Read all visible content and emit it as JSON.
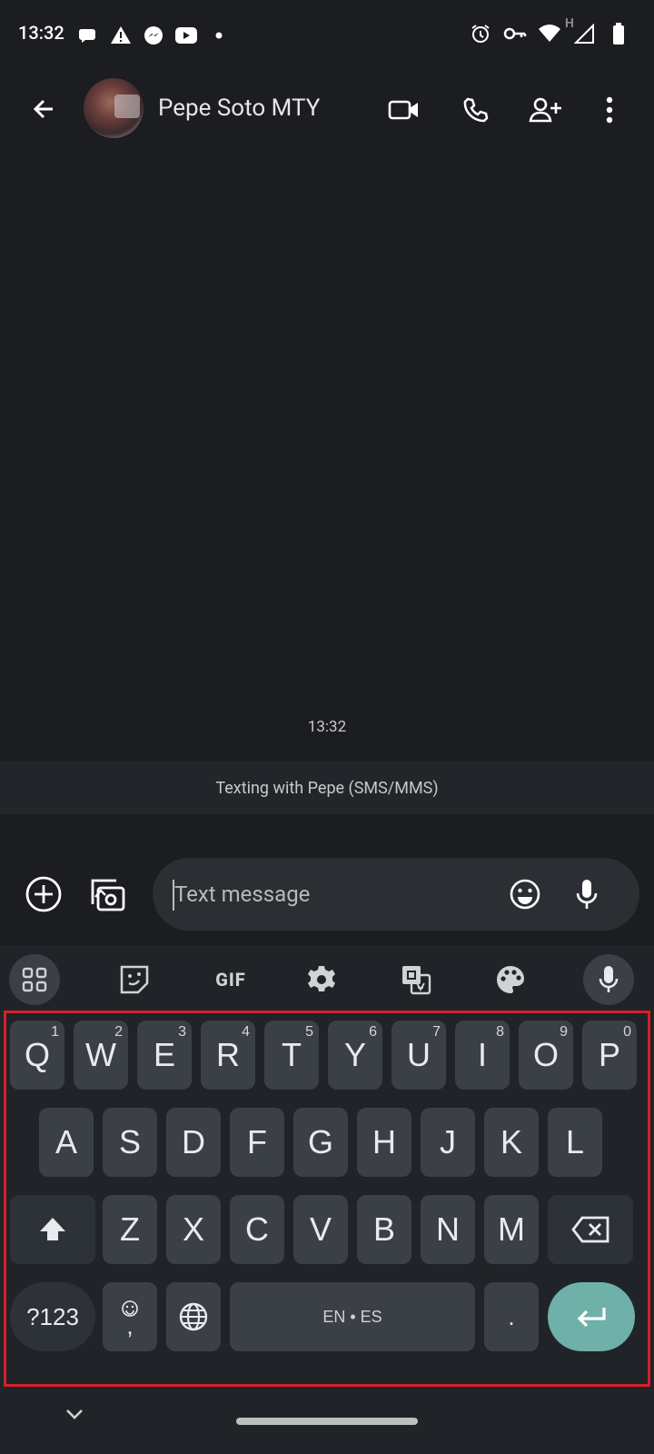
{
  "status_bar": {
    "time": "13:32",
    "network_label": "H"
  },
  "header": {
    "contact_name": "Pepe Soto MTY"
  },
  "conversation": {
    "timestamp": "13:32",
    "banner": "Texting with Pepe (SMS/MMS)"
  },
  "compose": {
    "placeholder": "Text message",
    "value": ""
  },
  "keyboard": {
    "toolbar": {
      "gif_label": "GIF"
    },
    "row1": [
      {
        "label": "Q",
        "hint": "1"
      },
      {
        "label": "W",
        "hint": "2"
      },
      {
        "label": "E",
        "hint": "3"
      },
      {
        "label": "R",
        "hint": "4"
      },
      {
        "label": "T",
        "hint": "5"
      },
      {
        "label": "Y",
        "hint": "6"
      },
      {
        "label": "U",
        "hint": "7"
      },
      {
        "label": "I",
        "hint": "8"
      },
      {
        "label": "O",
        "hint": "9"
      },
      {
        "label": "P",
        "hint": "0"
      }
    ],
    "row2": [
      "A",
      "S",
      "D",
      "F",
      "G",
      "H",
      "J",
      "K",
      "L"
    ],
    "row3": [
      "Z",
      "X",
      "C",
      "V",
      "B",
      "N",
      "M"
    ],
    "symbols_label": "?123",
    "comma_label": ",",
    "space_label": "EN • ES",
    "period_label": "."
  },
  "colors": {
    "accent": "#6fb0a8",
    "background": "#1b1d20",
    "highlight_border": "#d41f2a"
  }
}
